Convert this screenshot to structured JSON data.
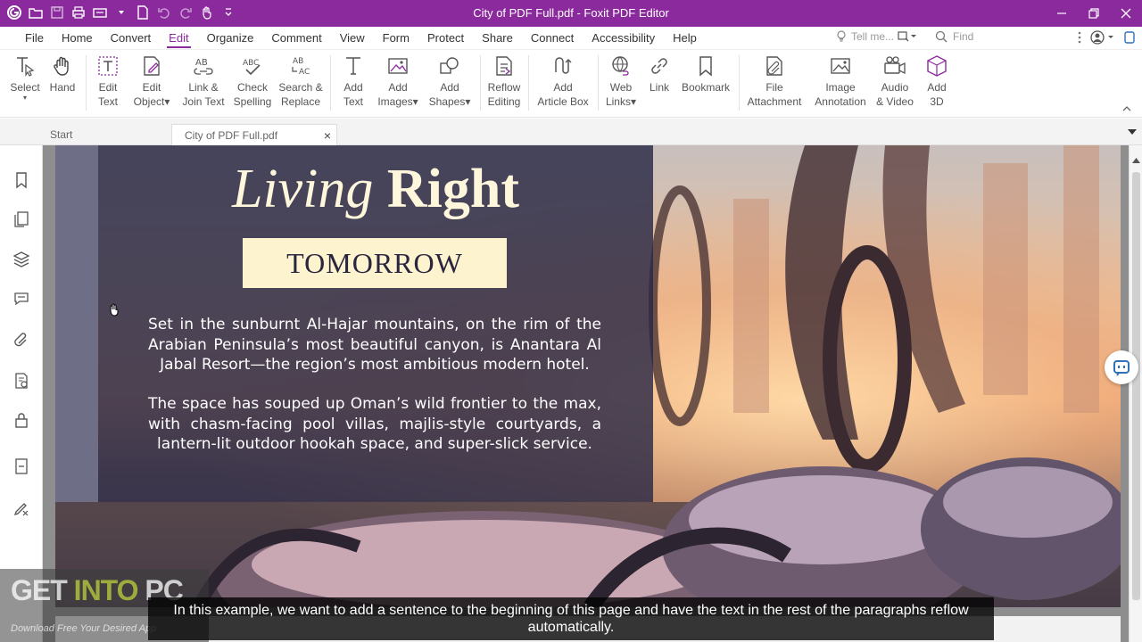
{
  "window": {
    "title": "City of PDF Full.pdf - Foxit PDF Editor",
    "accent_color": "#8a2a9c"
  },
  "menu": {
    "items": [
      "File",
      "Home",
      "Convert",
      "Edit",
      "Organize",
      "Comment",
      "View",
      "Form",
      "Protect",
      "Share",
      "Connect",
      "Accessibility",
      "Help"
    ],
    "active": "Edit",
    "tell_me_placeholder": "Tell me...",
    "find_placeholder": "Find"
  },
  "ribbon": {
    "select": {
      "line1": "Select",
      "line2": ""
    },
    "hand": {
      "line1": "Hand",
      "line2": ""
    },
    "edit_text": {
      "line1": "Edit",
      "line2": "Text"
    },
    "edit_object": {
      "line1": "Edit",
      "line2": "Object▾"
    },
    "link_join": {
      "line1": "Link &",
      "line2": "Join Text"
    },
    "check_spelling": {
      "line1": "Check",
      "line2": "Spelling"
    },
    "search_replace": {
      "line1": "Search &",
      "line2": "Replace"
    },
    "add_text": {
      "line1": "Add",
      "line2": "Text"
    },
    "add_images": {
      "line1": "Add",
      "line2": "Images▾"
    },
    "add_shapes": {
      "line1": "Add",
      "line2": "Shapes▾"
    },
    "reflow_editing": {
      "line1": "Reflow",
      "line2": "Editing"
    },
    "add_article_box": {
      "line1": "Add",
      "line2": "Article Box"
    },
    "web_links": {
      "line1": "Web",
      "line2": "Links▾"
    },
    "link": {
      "line1": "Link",
      "line2": ""
    },
    "bookmark": {
      "line1": "Bookmark",
      "line2": ""
    },
    "file_attachment": {
      "line1": "File",
      "line2": "Attachment"
    },
    "image_annotation": {
      "line1": "Image",
      "line2": "Annotation"
    },
    "audio_video": {
      "line1": "Audio",
      "line2": "& Video"
    },
    "add_3d": {
      "line1": "Add",
      "line2": "3D"
    }
  },
  "tabs": {
    "start": "Start",
    "document": "City of PDF Full.pdf",
    "close_glyph": "×"
  },
  "document": {
    "heading_italic": "Living",
    "heading_bold": "Right",
    "badge": "TOMORROW",
    "paragraph1": "Set in the sunburnt Al-Hajar mountains, on the rim of the Arabian Peninsula’s most beautiful canyon, is Anantara Al Jabal Resort—the region’s most ambitious modern hotel.",
    "paragraph2": "The space has souped up Oman’s wild frontier to the max, with chasm-facing pool villas, majlis-style courtyards, a lantern-lit outdoor hookah space, and super-slick service."
  },
  "watermark": {
    "get": "GET ",
    "into": "INTO",
    "pc": " PC",
    "tagline": "Download Free Your Desired App"
  },
  "subtitle": "In this example, we want to add a sentence to the beginning of this page and have the text in the rest of the paragraphs reflow automatically."
}
